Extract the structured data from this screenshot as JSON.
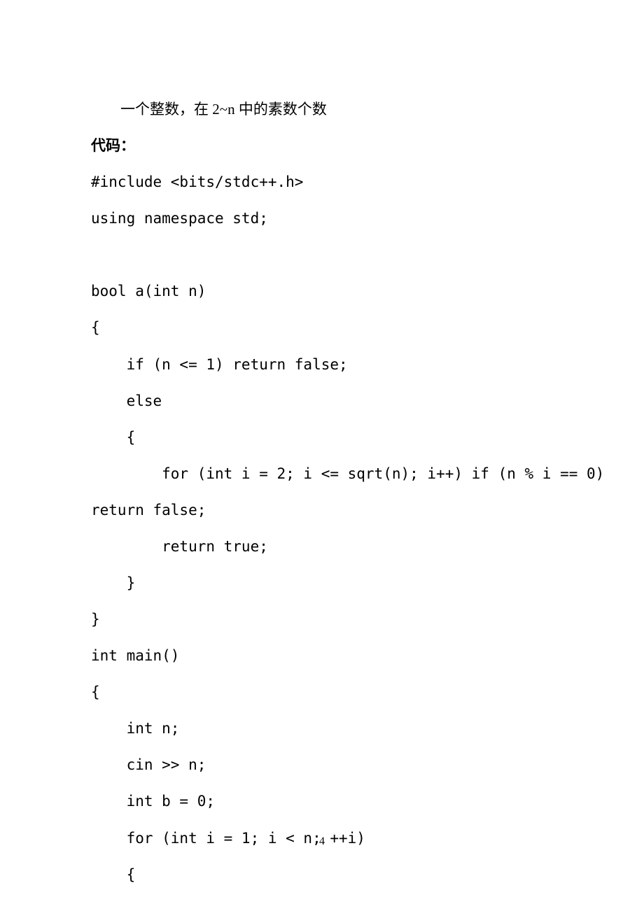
{
  "description": "一个整数，在 2~n 中的素数个数",
  "codeHeading": "代码：",
  "code": {
    "line1": "#include <bits/stdc++.h>",
    "line2": "using namespace std;",
    "line3": "",
    "line4": "bool a(int n)",
    "line5": "{",
    "line6": "    if (n <= 1) return false;",
    "line7": "    else",
    "line8": "    {",
    "line9a": "        for (int i = 2; i <= sqrt(n); i++) if (n % i == 0)",
    "line9b": "return false;",
    "line10": "        return true;",
    "line11": "    }",
    "line12": "}",
    "line13": "int main()",
    "line14": "{",
    "line15": "    int n;",
    "line16": "    cin >> n;",
    "line17": "    int b = 0;",
    "line18": "    for (int i = 1; i < n; ++i)",
    "line19": "    {"
  },
  "pageNumber": "4"
}
